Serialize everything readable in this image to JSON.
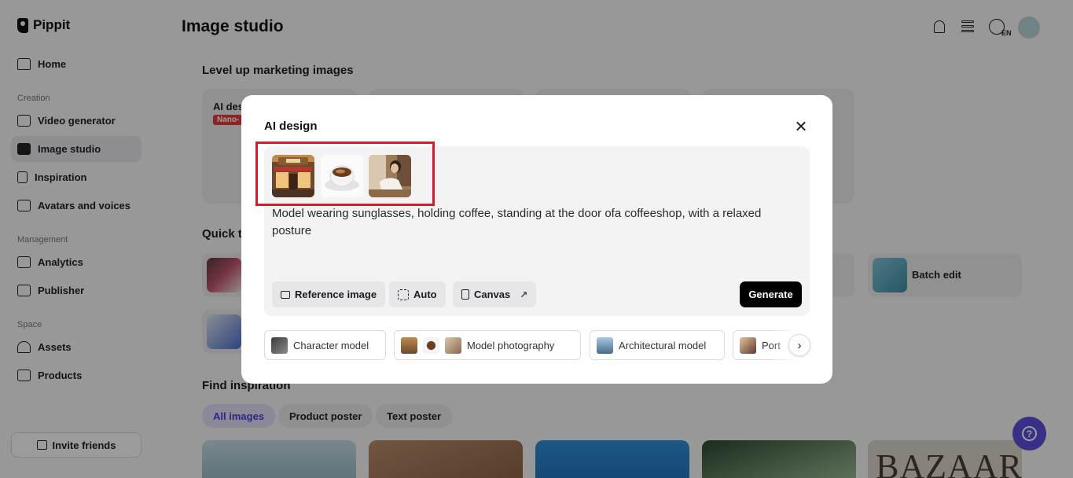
{
  "app": {
    "name": "Pippit"
  },
  "sidebar": {
    "primary": [
      {
        "label": "Home"
      }
    ],
    "sections": [
      {
        "title": "Creation",
        "items": [
          {
            "label": "Video generator"
          },
          {
            "label": "Image studio"
          },
          {
            "label": "Inspiration"
          },
          {
            "label": "Avatars and voices"
          }
        ]
      },
      {
        "title": "Management",
        "items": [
          {
            "label": "Analytics"
          },
          {
            "label": "Publisher"
          }
        ]
      },
      {
        "title": "Space",
        "items": [
          {
            "label": "Assets"
          },
          {
            "label": "Products"
          }
        ]
      }
    ],
    "active_item": "Image studio",
    "invite_label": "Invite friends"
  },
  "header": {
    "title": "Image studio",
    "language_badge": "EN",
    "icons": [
      "bell-icon",
      "stack-icon",
      "globe-icon",
      "avatar"
    ]
  },
  "main": {
    "section_marketing": "Level up marketing images",
    "feature_card": {
      "title": "AI des",
      "badge": "Nano-"
    },
    "section_quick": "Quick t",
    "quick_tools": [
      {
        "label": "Batch edit"
      }
    ],
    "section_inspiration": "Find inspiration",
    "filters": [
      {
        "label": "All images"
      },
      {
        "label": "Product poster"
      },
      {
        "label": "Text poster"
      }
    ],
    "active_filter": "All images",
    "inspiration_text": "BAZAAR"
  },
  "modal": {
    "title": "AI design",
    "reference_images": [
      "cafe-storefront",
      "coffee-cup",
      "woman-portrait"
    ],
    "prompt": "Model wearing sunglasses, holding coffee, standing at the door ofa coffeeshop, with a relaxed posture",
    "tools": {
      "reference": "Reference image",
      "auto": "Auto",
      "canvas": "Canvas"
    },
    "generate_label": "Generate",
    "templates": [
      {
        "label": "Character model"
      },
      {
        "label": "Model photography"
      },
      {
        "label": "Architectural model"
      },
      {
        "label": "Port"
      }
    ]
  },
  "colors": {
    "highlight": "#d11f2a",
    "accent": "#5b4ed8",
    "primary_button": "#000000"
  }
}
